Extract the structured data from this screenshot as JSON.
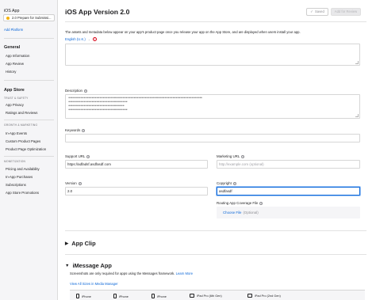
{
  "sidebar": {
    "app_title": "iOS App",
    "version_selector": "2.0 Prepare for Submissi...",
    "add_platform": "Add Platform",
    "general": {
      "heading": "General",
      "items": [
        "App Information",
        "App Review",
        "History"
      ]
    },
    "app_store": {
      "heading": "App Store",
      "trust_safety": {
        "category": "TRUST & SAFETY",
        "items": [
          "App Privacy",
          "Ratings and Reviews"
        ]
      },
      "growth_marketing": {
        "category": "GROWTH & MARKETING",
        "items": [
          "In-App Events",
          "Custom Product Pages",
          "Product Page Optimization"
        ]
      },
      "monetization": {
        "category": "MONETIZATION",
        "items": [
          "Pricing and Availability",
          "In-App Purchases",
          "Subscriptions",
          "App Store Promotions"
        ]
      }
    }
  },
  "header": {
    "title": "iOS App Version 2.0",
    "saved_label": "Saved",
    "submit_label": "Add for Review"
  },
  "main": {
    "intro": "The assets and metadata below appear on your app's product page once you release your app on the App Store, and are displayed when users install your app.",
    "language": "English (U.K.)",
    "description": {
      "label": "Description",
      "lines": [
        "**************************************************************************************",
        "**************************************",
        "************************************",
        "**************************************"
      ]
    },
    "keywords": {
      "label": "Keywords",
      "value": ""
    },
    "support_url": {
      "label": "Support URL",
      "value": "https://adfadsf.asdfasdf.com"
    },
    "marketing_url": {
      "label": "Marketing URL",
      "placeholder": "http://example.com (optional)"
    },
    "version": {
      "label": "Version",
      "value": "2.0"
    },
    "copyright": {
      "label": "Copyright",
      "value": "asdfasdf"
    },
    "routing": {
      "label": "Routing App Coverage File",
      "choose": "Choose File",
      "optional": "(Optional)"
    },
    "app_clip": {
      "title": "App Clip"
    },
    "imessage": {
      "title": "iMessage App",
      "subtitle": "Screenshots are only required for apps using the Messages framework.",
      "learn_more": "Learn More",
      "view_all": "View All Sizes in Media Manager",
      "devices": [
        "iPhone",
        "iPhone",
        "iPhone",
        "iPad Pro (6th Gen)",
        "iPad Pro (2nd Gen)"
      ]
    }
  },
  "colors": {
    "accent": "#0a66d8",
    "warning": "#d70015",
    "in_progress": "#f5b20a"
  }
}
